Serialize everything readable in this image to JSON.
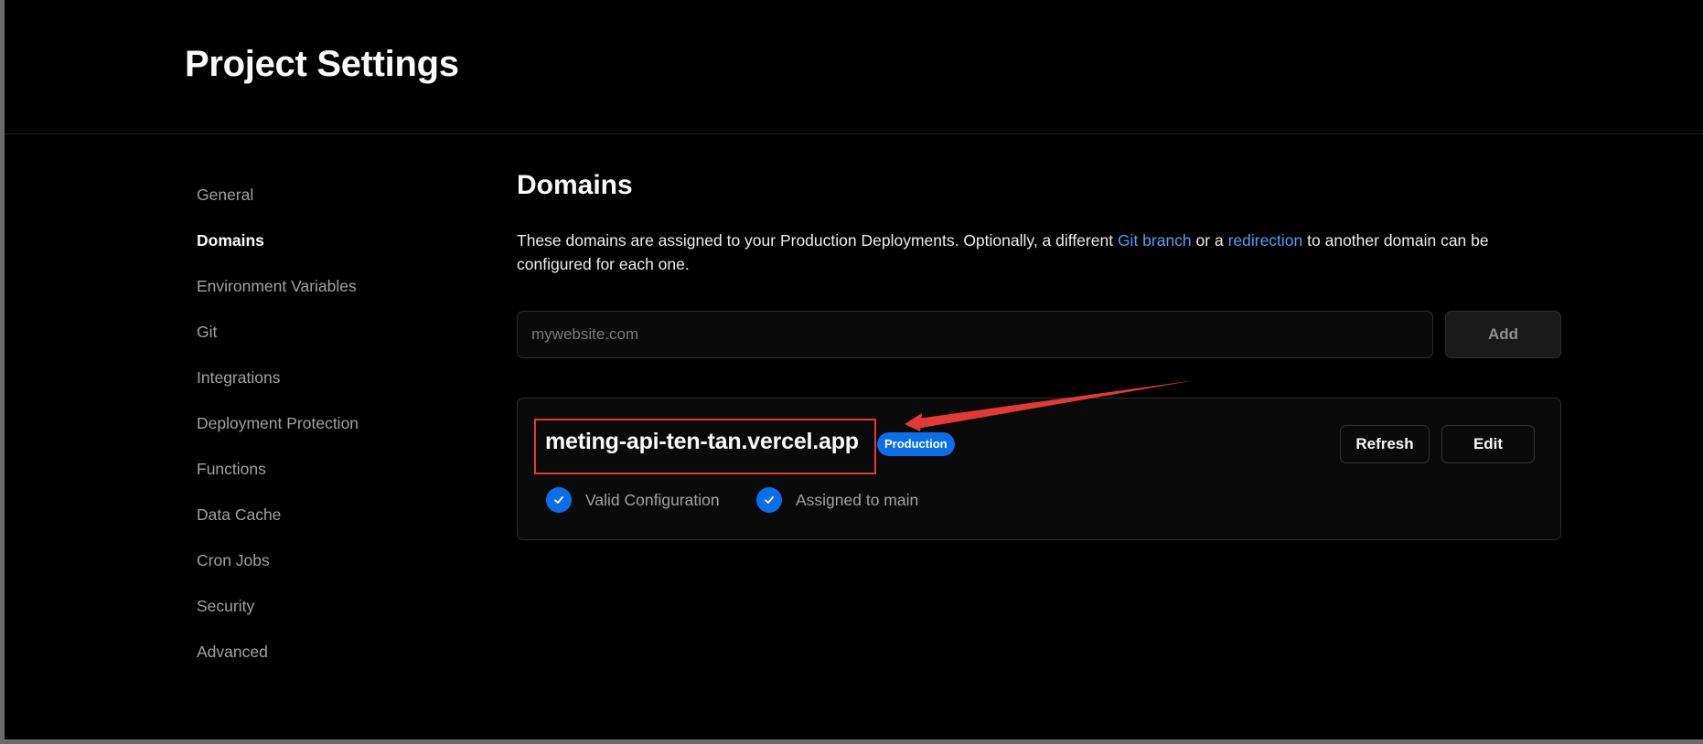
{
  "header": {
    "title": "Project Settings"
  },
  "sidebar": {
    "items": [
      {
        "label": "General",
        "active": false
      },
      {
        "label": "Domains",
        "active": true
      },
      {
        "label": "Environment Variables",
        "active": false
      },
      {
        "label": "Git",
        "active": false
      },
      {
        "label": "Integrations",
        "active": false
      },
      {
        "label": "Deployment Protection",
        "active": false
      },
      {
        "label": "Functions",
        "active": false
      },
      {
        "label": "Data Cache",
        "active": false
      },
      {
        "label": "Cron Jobs",
        "active": false
      },
      {
        "label": "Security",
        "active": false
      },
      {
        "label": "Advanced",
        "active": false
      }
    ]
  },
  "main": {
    "title": "Domains",
    "description": {
      "part1": "These domains are assigned to your Production Deployments. Optionally, a different ",
      "link1": "Git branch",
      "part2": " or a ",
      "link2": "redirection",
      "part3": " to another domain can be configured for each one."
    },
    "add_domain": {
      "placeholder": "mywebsite.com",
      "value": "",
      "button_label": "Add"
    },
    "domains": [
      {
        "name": "meting-api-ten-tan.vercel.app",
        "badge": "Production",
        "refresh_label": "Refresh",
        "edit_label": "Edit",
        "statuses": [
          "Valid Configuration",
          "Assigned to main"
        ]
      }
    ]
  },
  "colors": {
    "background": "#000000",
    "accent_blue": "#0a6fe8",
    "link_blue": "#5b9bf1",
    "annotation_red": "#e53935"
  },
  "icons": [
    "check-icon",
    "annotation-arrow-icon"
  ]
}
